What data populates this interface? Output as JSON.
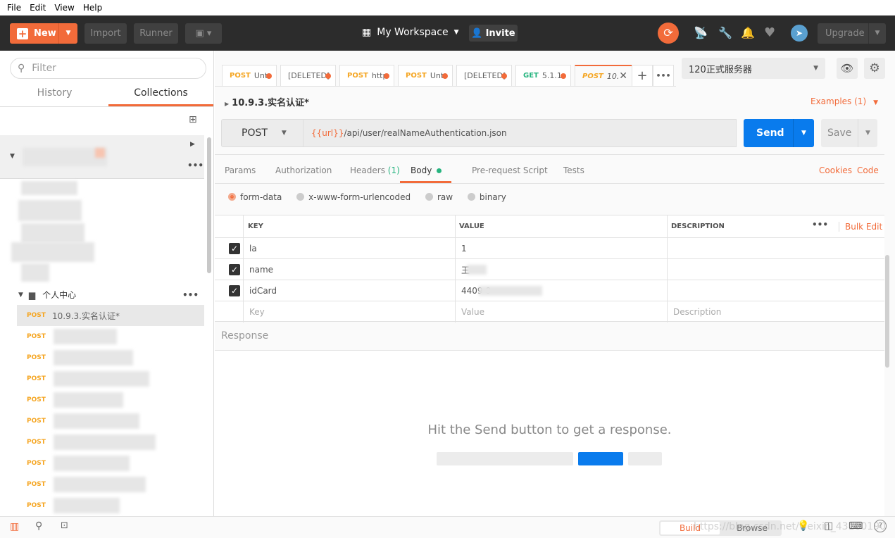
{
  "menu": [
    "File",
    "Edit",
    "View",
    "Help"
  ],
  "header": {
    "new_label": "New",
    "import_label": "Import",
    "runner_label": "Runner",
    "workspace": "My Workspace",
    "invite": "Invite",
    "upgrade": "Upgrade",
    "accent": "#f26b3a"
  },
  "sidebar": {
    "filter_placeholder": "Filter",
    "tabs": [
      "History",
      "Collections"
    ],
    "active_tab": "Collections",
    "folder": "个人中心",
    "active_request": {
      "method": "POST",
      "name": "10.9.3.实名认证*"
    },
    "post_label": "POST"
  },
  "tabs": [
    {
      "method": "POST",
      "name": "Unt"
    },
    {
      "method": "",
      "name": "[DELETED]"
    },
    {
      "method": "POST",
      "name": "http"
    },
    {
      "method": "POST",
      "name": "Unt"
    },
    {
      "method": "",
      "name": "[DELETED]"
    },
    {
      "method": "GET",
      "name": "5.1.1"
    },
    {
      "method": "POST",
      "name": "10."
    }
  ],
  "environment": "120正式服务器",
  "request": {
    "title": "10.9.3.实名认证*",
    "examples": "Examples (1)",
    "method": "POST",
    "url_var": "{{url}}",
    "url_path": "/api/user/realNameAuthentication.json",
    "send": "Send",
    "save": "Save"
  },
  "param_tabs": {
    "params": "Params",
    "authorization": "Authorization",
    "headers": "Headers",
    "headers_count": "(1)",
    "body": "Body",
    "prerequest": "Pre-request Script",
    "tests": "Tests",
    "cookies": "Cookies",
    "code": "Code"
  },
  "body_types": [
    "form-data",
    "x-www-form-urlencoded",
    "raw",
    "binary"
  ],
  "table": {
    "headers": [
      "KEY",
      "VALUE",
      "DESCRIPTION"
    ],
    "bulk_edit": "Bulk Edit",
    "rows": [
      {
        "key": "la",
        "value": "1",
        "checked": true
      },
      {
        "key": "name",
        "value": "王",
        "checked": true
      },
      {
        "key": "idCard",
        "value": "4409          0",
        "checked": true
      }
    ],
    "placeholders": {
      "key": "Key",
      "value": "Value",
      "description": "Description"
    }
  },
  "response": {
    "label": "Response",
    "empty": "Hit the Send button to get a response."
  },
  "statusbar": {
    "build": "Build",
    "browse": "Browse",
    "watermark": "https://blog.csdn.net/weixin_43160190"
  }
}
